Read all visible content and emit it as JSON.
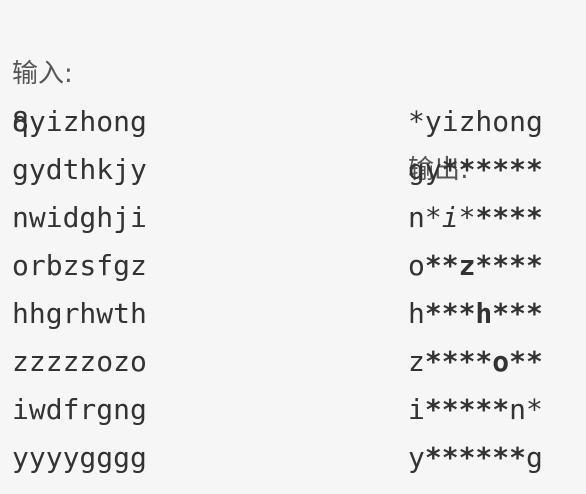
{
  "input_label": "输入:",
  "output_label": "输出:",
  "count": "8",
  "rows": [
    {
      "input": "qyizhong",
      "output": [
        {
          "t": "*yizhong",
          "s": "n"
        }
      ]
    },
    {
      "input": "gydthkjy",
      "output": [
        {
          "t": "gy",
          "s": "n"
        },
        {
          "t": "******",
          "s": "b"
        }
      ]
    },
    {
      "input": "nwidghji",
      "output": [
        {
          "t": "n",
          "s": "n"
        },
        {
          "t": "*i*",
          "s": "i"
        },
        {
          "t": "****",
          "s": "b"
        }
      ]
    },
    {
      "input": "orbzsfgz",
      "output": [
        {
          "t": "o",
          "s": "n"
        },
        {
          "t": "**z****",
          "s": "b"
        }
      ]
    },
    {
      "input": "hhgrhwth",
      "output": [
        {
          "t": "h",
          "s": "n"
        },
        {
          "t": "***h***",
          "s": "b"
        }
      ]
    },
    {
      "input": "zzzzzozo",
      "output": [
        {
          "t": "z",
          "s": "n"
        },
        {
          "t": "****o**",
          "s": "b"
        }
      ]
    },
    {
      "input": "iwdfrgng",
      "output": [
        {
          "t": "i",
          "s": "n"
        },
        {
          "t": "*****",
          "s": "b"
        },
        {
          "t": "n*",
          "s": "n"
        }
      ]
    },
    {
      "input": "yyyygggg",
      "output": [
        {
          "t": "y",
          "s": "n"
        },
        {
          "t": "******",
          "s": "b"
        },
        {
          "t": "g",
          "s": "n"
        }
      ]
    }
  ]
}
